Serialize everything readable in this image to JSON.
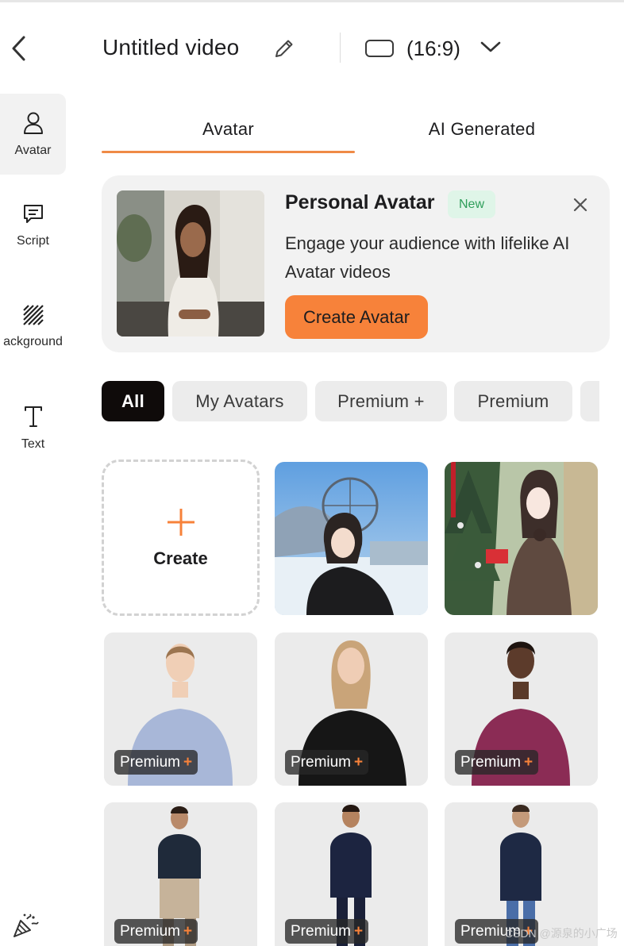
{
  "header": {
    "title": "Untitled video",
    "aspect_ratio": "(16:9)"
  },
  "sidebar": {
    "items": [
      {
        "label": "Avatar",
        "icon": "user-icon",
        "active": true
      },
      {
        "label": "Script",
        "icon": "script-icon",
        "active": false
      },
      {
        "label": "ackground",
        "icon": "background-icon",
        "active": false
      },
      {
        "label": "Text",
        "icon": "text-icon",
        "active": false
      }
    ]
  },
  "tabs": [
    {
      "label": "Avatar",
      "active": true
    },
    {
      "label": "AI Generated",
      "active": false
    }
  ],
  "promo": {
    "title": "Personal Avatar",
    "badge": "New",
    "description": "Engage your audience with lifelike AI Avatar videos",
    "button": "Create Avatar"
  },
  "filters": [
    {
      "label": "All",
      "active": true
    },
    {
      "label": "My Avatars",
      "active": false
    },
    {
      "label": "Premium +",
      "active": false
    },
    {
      "label": "Premium",
      "active": false
    }
  ],
  "grid": {
    "create_label": "Create",
    "premium_label": "Premium",
    "premium_plus": "+"
  },
  "watermark": "CSDN @源泉的小广场",
  "colors": {
    "accent": "#f7823a",
    "tab_underline": "#ef8a46",
    "new_badge_bg": "#dff5e8",
    "new_badge_text": "#2f9e5a",
    "chip_active": "#0f0b0a"
  }
}
